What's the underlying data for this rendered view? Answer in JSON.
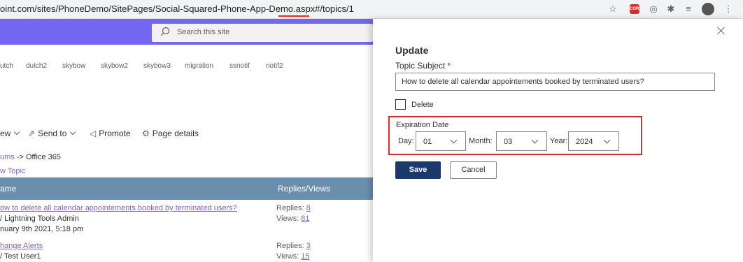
{
  "browser": {
    "url_main": "oint.com/sites/PhoneDemo/SitePages/Social-Squared-Phone-App-Demo.aspx#",
    "url_hash": "/topics/1"
  },
  "search": {
    "placeholder": "Search this site"
  },
  "hub_nav": [
    "utch",
    "dutch2",
    "skybow",
    "skybow2",
    "skybow3",
    "migration",
    "ssnotif",
    "notif2"
  ],
  "command_bar": {
    "view": "ew",
    "send_to": "Send to",
    "promote": "Promote",
    "page_details": "Page details"
  },
  "breadcrumb": {
    "link": "ums",
    "rest": "-> Office 365"
  },
  "new_topic": "w Topic",
  "table": {
    "col_name": "ame",
    "col_replies_views": "Replies/Views",
    "rows": [
      {
        "title": "ow to delete all calendar appointements booked by terminated users?",
        "author": "/ Lightning Tools Admin",
        "date": "nuary 9th 2021, 5:18 pm",
        "replies_label": "Replies: ",
        "replies": "8",
        "views_label": "Views: ",
        "views": "81"
      },
      {
        "title": "hange Alerts",
        "author": "/ Test User1",
        "replies_label": "Replies: ",
        "replies": "3",
        "views_label": "Views: ",
        "views": "15"
      }
    ]
  },
  "panel": {
    "title": "Update",
    "topic_subject_label": "Topic Subject",
    "required_mark": "*",
    "topic_subject_value": "How to delete all calendar appointements booked by terminated users?",
    "delete_label": "Delete",
    "expiration_label": "Expiration Date",
    "day_label": "Day:",
    "day_value": "01",
    "month_label": "Month:",
    "month_value": "03",
    "year_label": "Year:",
    "year_value": "2024",
    "save_label": "Save",
    "cancel_label": "Cancel"
  },
  "colors": {
    "suite_bar": "#7367f0",
    "table_header": "#6a8fad",
    "save_button": "#1b3a6b",
    "highlight": "#d32f2f"
  }
}
